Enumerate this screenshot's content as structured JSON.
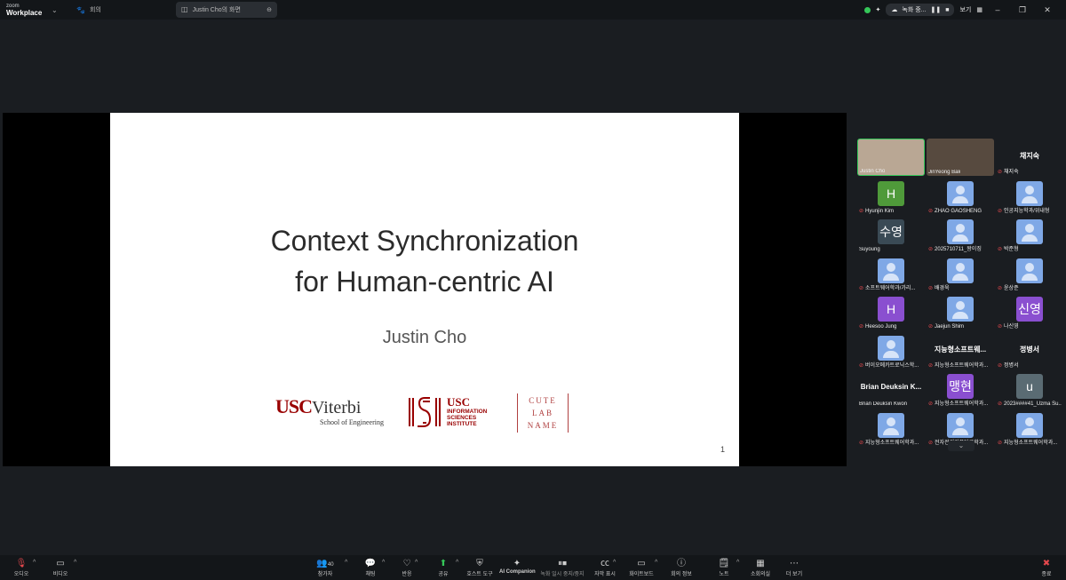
{
  "titlebar": {
    "brand_top": "zoom",
    "brand_bottom": "Workplace",
    "tab_meeting": "회의",
    "tab_share": "Justin Cho의 화면",
    "rec_label": "녹화 중...",
    "view_label": "보기"
  },
  "slide": {
    "title_line1": "Context Synchronization",
    "title_line2": "for Human-centric AI",
    "author": "Justin Cho",
    "page_number": "1",
    "logo_usc": "USC",
    "logo_viterbi": "Viterbi",
    "logo_viterbi_sub": "School of Engineering",
    "logo_isi_usc": "USC",
    "logo_isi_line1": "INFORMATION",
    "logo_isi_line2": "SCIENCES",
    "logo_isi_line3": "INSTITUTE",
    "logo_cute_1": "CUTE",
    "logo_cute_2": "LAB",
    "logo_cute_3": "NAME"
  },
  "participants": [
    {
      "name": "Justin Cho",
      "muted": false
    },
    {
      "name": "JinYeong Bak",
      "muted": false
    },
    {
      "name": "채지숙",
      "muted": true,
      "big": "채지숙"
    },
    {
      "name": "Hyunjin Kim",
      "muted": true,
      "avatar": "H",
      "color": "#4f9a3a"
    },
    {
      "name": "ZHAO GAOSHENG",
      "muted": true
    },
    {
      "name": "인공지능학과/위내형",
      "muted": true
    },
    {
      "name": "Suyoung",
      "muted": false,
      "avatar": "수영",
      "color": "#3a4a55"
    },
    {
      "name": "2025710711_왕이징",
      "muted": true
    },
    {
      "name": "박준형",
      "muted": true
    },
    {
      "name": "소프트웨어학과/가리...",
      "muted": true
    },
    {
      "name": "배경욱",
      "muted": true
    },
    {
      "name": "윤상준",
      "muted": true
    },
    {
      "name": "Heesoo Jung",
      "muted": true,
      "avatar": "H",
      "color": "#8a4fd0"
    },
    {
      "name": "Jaejun Shim",
      "muted": true
    },
    {
      "name": "나신영",
      "muted": true,
      "avatar": "신영",
      "color": "#8a4fd0"
    },
    {
      "name": "버이오메카트로닉스학...",
      "muted": true
    },
    {
      "name": "지능형소프트웨어학과...",
      "muted": true,
      "big": "지능형소프트웨..."
    },
    {
      "name": "정병서",
      "muted": true,
      "big": "정병서"
    },
    {
      "name": "Brian Deuksin Kwon",
      "muted": false,
      "big": "Brian Deuksin K..."
    },
    {
      "name": "지능형소프트웨어학과...",
      "muted": true,
      "avatar": "맹현",
      "color": "#8a4fd0"
    },
    {
      "name": "2023####41_Uzma Su...",
      "muted": true,
      "avatar": "u",
      "color": "#5a6b73"
    },
    {
      "name": "지능형소프트웨어학과...",
      "muted": true
    },
    {
      "name": "전자전기컴퓨터공학과...",
      "muted": true
    },
    {
      "name": "지능형소프트웨어학과...",
      "muted": true
    }
  ],
  "toolbar": {
    "audio": "오디오",
    "video": "비디오",
    "participants": "참가자",
    "participant_count": "40",
    "chat": "채팅",
    "react": "반응",
    "share": "공유",
    "host_tools": "호스트 도구",
    "ai_companion": "AI Companion",
    "record": "녹화 일시 중지/중지",
    "captions": "자막 표시",
    "whiteboard": "화이트보드",
    "meeting_info": "회의 정보",
    "notes": "노트",
    "breakout": "소회의실",
    "more": "더 보기",
    "end": "종료"
  }
}
